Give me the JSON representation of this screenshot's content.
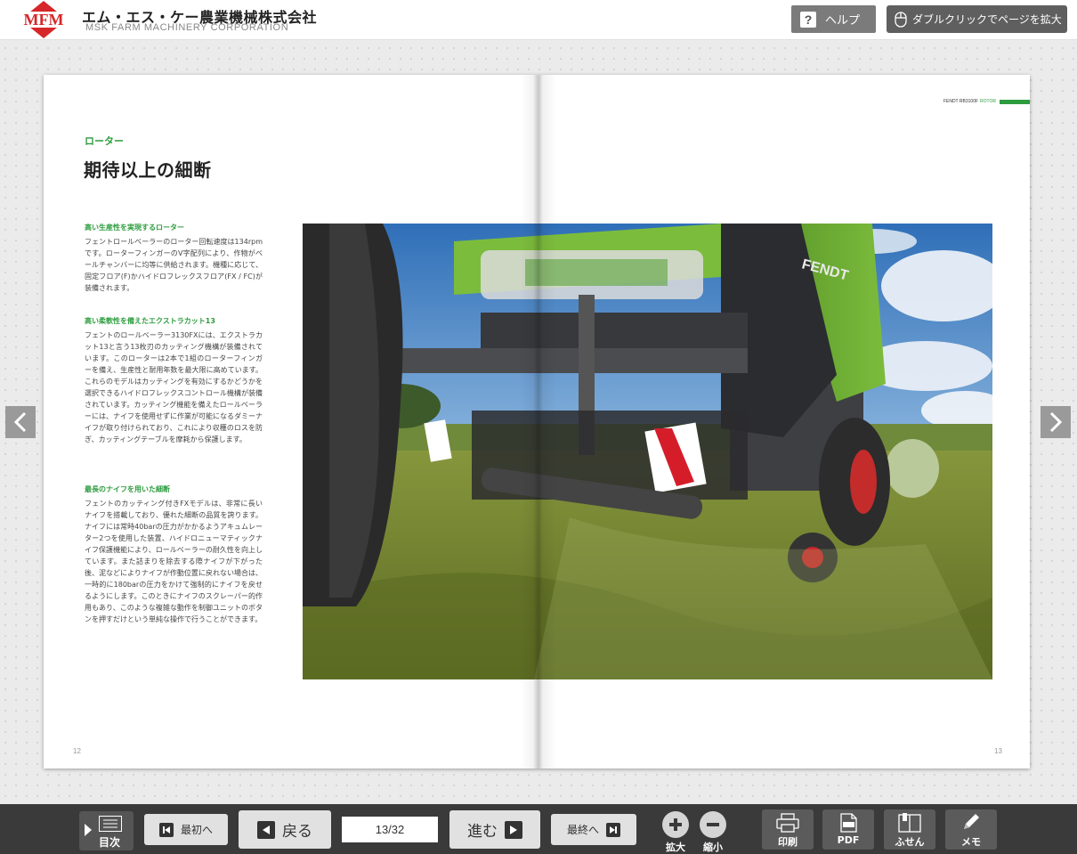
{
  "header": {
    "logo_text": "MFM",
    "company_jp": "エム・エス・ケー農業機械株式会社",
    "company_en": "MSK FARM MACHINERY CORPORATION",
    "help_label": "ヘルプ",
    "zoom_hint": "ダブルクリックでページを拡大"
  },
  "page_left": {
    "section": "ローター",
    "title": "期待以上の細断",
    "blocks": [
      {
        "heading": "高い生産性を実現するローター",
        "body": "フェントロールベーラーのローター回転速度は134rpmです。ローターフィンガーのV字配列により、作物がベールチャンバーに均等に供給されます。機種に応じて、固定フロア(F)かハイドロフレックスフロア(FX / FC)が装備されます。"
      },
      {
        "heading": "高い柔軟性を備えたエクストラカット13",
        "body": "フェントのロールベーラー3130FXには、エクストラカット13と言う13枚刃のカッティング機構が装備されています。このローターは2本で1組のローターフィンガーを備え、生産性と耐用年数を最大限に高めています。これらのモデルはカッティングを有効にするかどうかを選択できるハイドロフレックスコントロール機構が装備されています。カッティング機能を備えたロールベーラーには、ナイフを使用せずに作業が可能になるダミーナイフが取り付けられており、これにより収穫のロスを防ぎ、カッティングテーブルを摩耗から保護します。"
      },
      {
        "heading": "最長のナイフを用いた細断",
        "body": "フェントのカッティング付きFXモデルは、非常に長いナイフを搭載しており、優れた細断の品質を誇ります。ナイフには常時40barの圧力がかかるようアキュムレーター2つを使用した装置、ハイドロニューマティックナイフ保護機能により、ロールベーラーの耐久性を向上しています。また詰まりを除去する際ナイフが下がった後、泥などによりナイフが作動位置に戻れない場合は、一時的に180barの圧力をかけて強制的にナイフを戻せるようにします。このときにナイフのスクレーパー的作用もあり、このような複雑な動作を制御ユニットのボタンを押すだけという単純な操作で行うことができます。"
      }
    ],
    "page_number": "12"
  },
  "page_right": {
    "running_head": "FENDT RB3100F",
    "running_head_accent": "ROTOR",
    "page_number": "13",
    "photo_brand": "FENDT"
  },
  "footer": {
    "toc_label": "目次",
    "first_label": "最初へ",
    "back_label": "戻る",
    "page_indicator": "13/32",
    "forward_label": "進む",
    "last_label": "最終へ",
    "zoom_in_label": "拡大",
    "zoom_out_label": "縮小",
    "print_label": "印刷",
    "pdf_label": "PDF",
    "sticky_label": "ふせん",
    "memo_label": "メモ"
  },
  "colors": {
    "accent_green": "#2d9c3e",
    "logo_red": "#d7262a",
    "footer_bg": "#3a3a3a"
  }
}
